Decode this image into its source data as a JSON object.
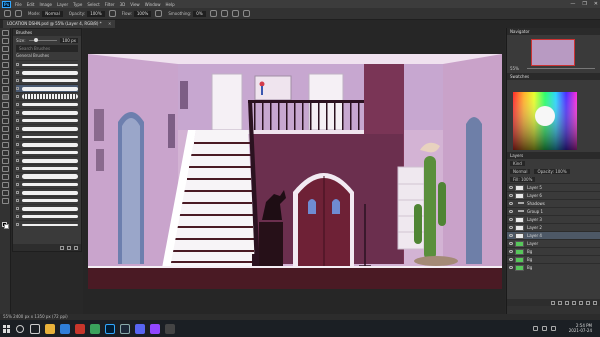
{
  "app": {
    "logo": "Ps",
    "menu": [
      "File",
      "Edit",
      "Image",
      "Layer",
      "Type",
      "Select",
      "Filter",
      "3D",
      "View",
      "Window",
      "Help"
    ],
    "window_controls": [
      "—",
      "❐",
      "✕"
    ]
  },
  "options_bar": {
    "mode_label": "Mode:",
    "mode_value": "Normal",
    "opacity_label": "Opacity:",
    "opacity_value": "100%",
    "flow_label": "Flow:",
    "flow_value": "100%",
    "smoothing_label": "Smoothing:",
    "smoothing_value": "0%"
  },
  "document": {
    "tab_title": "LOCATION DSHN.psd @ 55% (Layer 4, RGB/8) *",
    "tab_close": "✕"
  },
  "brushes_panel": {
    "title": "Brushes",
    "size_label": "Size:",
    "size_value": "100 px",
    "search_placeholder": "Search Brushes",
    "group_label": "General Brushes"
  },
  "right_panels": {
    "navigator_title": "Navigator",
    "navigator_zoom": "55%",
    "swatches_title": "Swatches",
    "layers_title": "Layers",
    "layers_kind": "Kind",
    "layers_blend": "Normal",
    "layers_opacity": "Opacity: 100%",
    "layers_fill": "Fill: 100%",
    "layers": [
      {
        "name": "Layer 5",
        "type": "layer",
        "selected": false
      },
      {
        "name": "Layer 6",
        "type": "layer",
        "selected": false
      },
      {
        "name": "Shadows",
        "type": "folder",
        "selected": false
      },
      {
        "name": "Group 1",
        "type": "folder",
        "selected": false
      },
      {
        "name": "Layer 3",
        "type": "layer",
        "selected": false
      },
      {
        "name": "Layer 2",
        "type": "layer",
        "selected": false
      },
      {
        "name": "Layer 4",
        "type": "layer",
        "selected": true
      },
      {
        "name": "Layer",
        "type": "green",
        "selected": false
      },
      {
        "name": "Bg",
        "type": "green",
        "selected": false
      },
      {
        "name": "Bg",
        "type": "green",
        "selected": false
      },
      {
        "name": "Bg",
        "type": "green",
        "selected": false
      }
    ]
  },
  "status_bar": {
    "text": "55%    2400 px x 1350 px (72 ppi)"
  },
  "taskbar": {
    "time": "2:54 PM",
    "date": "2021-07-24"
  },
  "colors": {
    "wall_light": "#d9b9d8",
    "wall_mid": "#b78fc0",
    "wall_accent": "#6b2f4e",
    "door": "#6e2136",
    "floor": "#4a1a24",
    "stairs": "#ffffff",
    "cactus": "#5a8f3c"
  }
}
